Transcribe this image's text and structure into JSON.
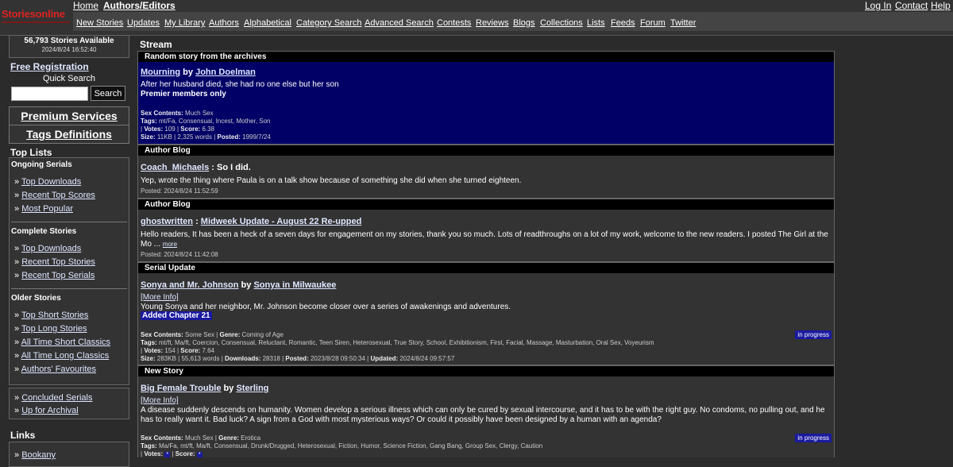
{
  "logo": {
    "text": "Storiesonline"
  },
  "top_nav": {
    "home": "Home",
    "authors": "Authors/Editors",
    "login": "Log In",
    "contact": "Contact",
    "help": "Help"
  },
  "main_nav": [
    "New Stories",
    "Updates",
    "My Library",
    "Authors",
    "Alphabetical",
    "Category Search",
    "Advanced Search",
    "Contests",
    "Reviews",
    "Blogs",
    "Collections",
    "Lists",
    "Feeds",
    "Forum",
    "Twitter"
  ],
  "sidebar": {
    "stories_count": "56,793 Stories Available",
    "timestamp": "2024/8/24 16:52:40",
    "free_registration": "Free Registration",
    "quick_search_label": "Quick Search",
    "quick_search_value": "",
    "search_button": "Search",
    "premium": "Premium Services",
    "tags": "Tags Definitions",
    "top_lists": "Top Lists",
    "ongoing": {
      "title": "Ongoing Serials",
      "items": [
        "Top Downloads",
        "Recent Top Scores",
        "Most Popular"
      ]
    },
    "complete": {
      "title": "Complete Stories",
      "items": [
        "Top Downloads",
        "Recent Top Stories",
        "Recent Top Serials"
      ]
    },
    "older": {
      "title": "Older Stories",
      "items": [
        "Top Short Stories",
        "Top Long Stories",
        "All Time Short Classics",
        "All Time Long Classics",
        "Authors' Favourites"
      ]
    },
    "extra": [
      "Concluded Serials",
      "Up for Archival"
    ],
    "links_title": "Links",
    "links_items": [
      "Bookany"
    ]
  },
  "stream": {
    "title": "Stream",
    "cards": [
      {
        "header": "Random story from the archives",
        "title": "Mourning",
        "by": "by",
        "author": "John Doelman",
        "summary": "After her husband died, she had no one else but her son",
        "note": "Premier members only",
        "sex_contents_label": "Sex Contents:",
        "sex_contents": "Much Sex",
        "tags_label": "Tags:",
        "tags": "mt/Fa, Consensual, Incest, Mother, Son",
        "votes_label": "Votes:",
        "votes": "109",
        "score_label": "Score:",
        "score": "6.38",
        "size_label": "Size:",
        "size": "11KB",
        "words": "2,325 words",
        "posted_label": "Posted:",
        "posted": "1999/7/24"
      },
      {
        "header": "Author Blog",
        "author": "Coach_Michaels",
        "sep": ":",
        "title": "So I did.",
        "body": "Yep, wrote the thing where Paula is on a talk show because of something she did when she turned eighteen.",
        "posted": "Posted: 2024/8/24 11:52:59"
      },
      {
        "header": "Author Blog",
        "author": "ghostwritten",
        "sep": ":",
        "title": "Midweek Update - August 22 Re-upped",
        "body": "Hello readers, It has been a heck of a seven days for engagement on my stories, thank you so much. Lots of readthroughs on a lot of my work, welcome to the new readers. I posted The Girl at the Mo ...",
        "more": "more",
        "posted": "Posted: 2024/8/24 11:42:08"
      },
      {
        "header": "Serial Update",
        "title": "Sonya and Mr. Johnson",
        "by": "by",
        "author": "Sonya in Milwaukee",
        "more_info": "[More Info]",
        "summary": "Young Sonya and her neighbor, Mr. Johnson become closer over a series of awakenings and adventures.",
        "added": "Added Chapter 21",
        "badge": "in progress",
        "sex_contents_label": "Sex Contents:",
        "sex_contents": "Some Sex",
        "genre_label": "Genre:",
        "genre": "Coming of Age",
        "tags_label": "Tags:",
        "tags": "mt/ft, Ma/ft, Coercion, Consensual, Reluctant, Romantic, Teen Siren, Heterosexual, True Story, School, Exhibitionism, First, Facial, Massage, Masturbation, Oral Sex, Voyeurism",
        "votes_label": "Votes:",
        "votes": "154",
        "score_label": "Score:",
        "score": "7.64",
        "size_label": "Size:",
        "size": "283KB",
        "words": "55,613 words",
        "downloads_label": "Downloads:",
        "downloads": "28318",
        "posted_label": "Posted:",
        "posted": "2023/8/28 09:50:34",
        "updated_label": "Updated:",
        "updated": "2024/8/24 09:57:57"
      },
      {
        "header": "New Story",
        "title": "Big Female Trouble",
        "by": "by",
        "author": "Sterling",
        "more_info": "[More Info]",
        "summary": "A disease suddenly descends on humanity. Women develop a serious illness which can only be cured by sexual intercourse, and it has to be with the right guy. No condoms, no pulling out, and he has to really want it. Bad luck? A sign from a God with most mysterious ways? Or could it possibly have been designed by a human with an agenda?",
        "badge": "in progress",
        "sex_contents_label": "Sex Contents:",
        "sex_contents": "Much Sex",
        "genre_label": "Genre:",
        "genre": "Erotica",
        "tags_label": "Tags:",
        "tags": "Ma/Fa, mt/ft, Ma/ft, Consensual, Drunk/Drugged, Heterosexual, Fiction, Humor, Science Fiction, Gang Bang, Group Sex, Clergy, Caution",
        "votes_label": "Votes:",
        "votes": "*",
        "score_label": "Score:",
        "score": "*"
      }
    ]
  },
  "colors": {
    "background": "#2b2b2b",
    "card": "#333333",
    "highlight_card": "#000066",
    "badge": "#1a1aa0",
    "logo": "#dd2222"
  }
}
